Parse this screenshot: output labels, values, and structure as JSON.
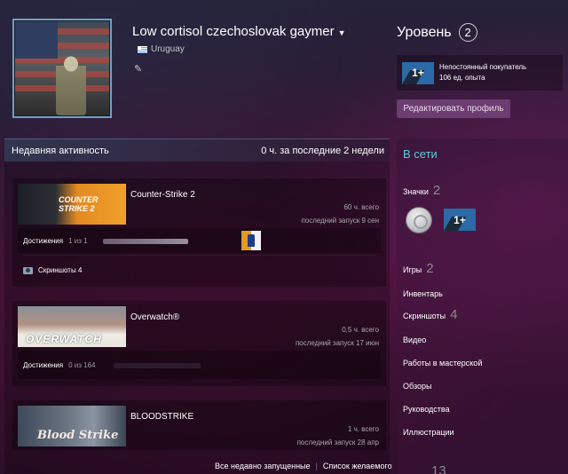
{
  "profile": {
    "persona_name": "Low cortisol czechoslovak gaymer",
    "location": "Uruguay"
  },
  "level": {
    "title": "Уровень",
    "value": "2"
  },
  "favorite_badge": {
    "icon_text": "1+",
    "name": "Непостоянный покупатель",
    "xp": "106 ед. опыта"
  },
  "edit_profile_label": "Редактировать профиль",
  "activity": {
    "title": "Недавняя активность",
    "summary": "0 ч. за последние 2 недели",
    "games": [
      {
        "name": "Counter-Strike 2",
        "capsule_text": "COUNTER STRIKE 2",
        "total": "60 ч. всего",
        "last_played": "последний запуск 9 сен",
        "achievements_label": "Достижения",
        "achievements_count": "1 из 1",
        "achievements_progress": 1.0,
        "screenshots_label": "Скриншоты 4"
      },
      {
        "name": "Overwatch®",
        "capsule_text": "OVERWATCH",
        "total": "0,5 ч. всего",
        "last_played": "последний запуск 17 июн",
        "achievements_label": "Достижения",
        "achievements_count": "0 из 164",
        "achievements_progress": 0.0
      },
      {
        "name": "BLOODSTRIKE",
        "capsule_text": "Blood Strike",
        "total": "1 ч. всего",
        "last_played": "последний запуск 28 апр"
      }
    ],
    "links": {
      "all_recent": "Все недавно запущенные",
      "separator": "|",
      "wishlist": "Список желаемого"
    }
  },
  "sidebar": {
    "status": "В сети",
    "badges_label": "Значки",
    "badges_count": "2",
    "badge_icon_text": "1+",
    "games_label": "Игры",
    "games_count": "2",
    "inventory_label": "Инвентарь",
    "screenshots_label": "Скриншоты",
    "screenshots_count": "4",
    "videos_label": "Видео",
    "workshop_label": "Работы в мастерской",
    "reviews_label": "Обзоры",
    "guides_label": "Руководства",
    "artwork_label": "Иллюстрации",
    "bottom_count": "13"
  },
  "colors": {
    "online_status": "#57cbde",
    "edit_button": "#6d3c73",
    "avatar_border": "#6fa2c7"
  }
}
